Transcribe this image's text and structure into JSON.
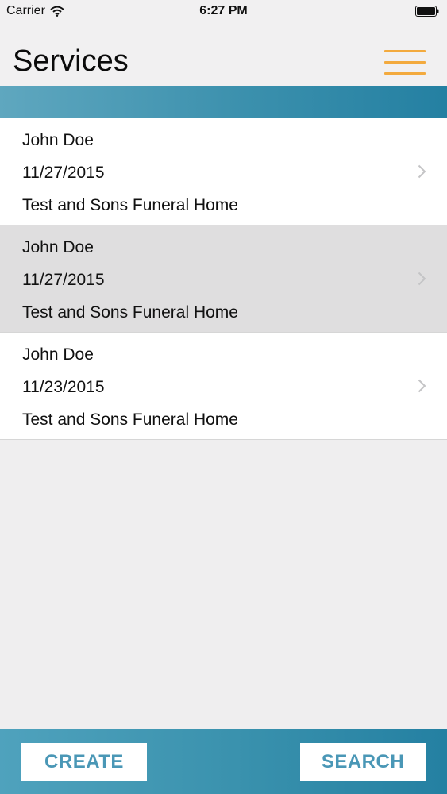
{
  "status_bar": {
    "carrier": "Carrier",
    "time": "6:27 PM"
  },
  "header": {
    "title": "Services",
    "menu_icon": "hamburger-menu-icon",
    "menu_color": "#f3aa3e"
  },
  "colors": {
    "accent_band": "#3b90ad",
    "selected_row": "#dfdedf",
    "button_text": "#4a97b6"
  },
  "services": [
    {
      "name": "John Doe",
      "date": "11/27/2015",
      "funeral_home": "Test and Sons Funeral Home",
      "selected": false
    },
    {
      "name": "John Doe",
      "date": "11/27/2015",
      "funeral_home": "Test and Sons Funeral Home",
      "selected": true
    },
    {
      "name": "John Doe",
      "date": "11/23/2015",
      "funeral_home": "Test and Sons Funeral Home",
      "selected": false
    }
  ],
  "toolbar": {
    "create_label": "CREATE",
    "search_label": "SEARCH"
  }
}
